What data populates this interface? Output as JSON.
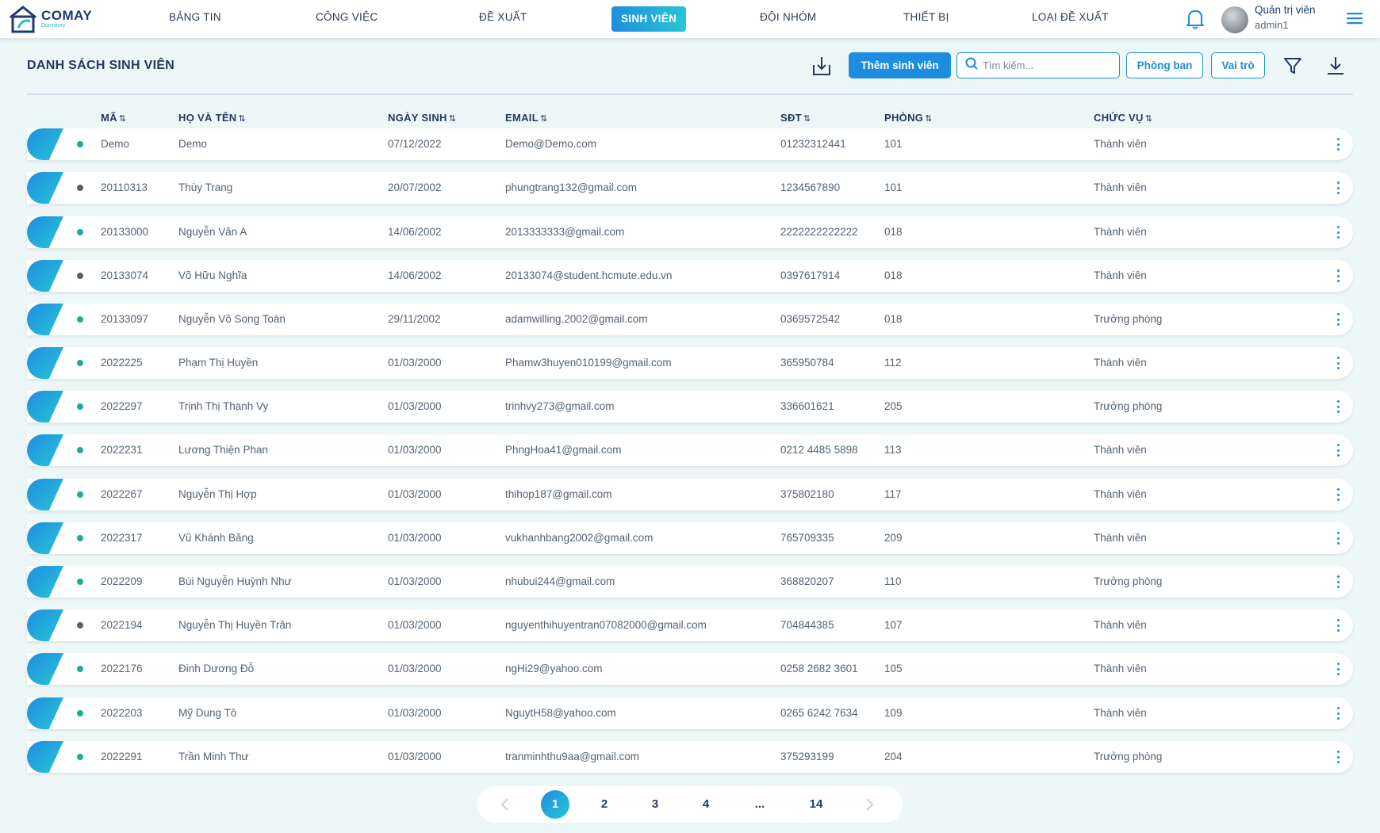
{
  "brand": {
    "name": "COMAY",
    "subtitle": "Dormitory"
  },
  "nav": {
    "items": [
      {
        "label": "BẢNG TIN"
      },
      {
        "label": "CÔNG VIỆC"
      },
      {
        "label": "ĐỀ XUẤT"
      },
      {
        "label": "SINH VIÊN",
        "active": true
      },
      {
        "label": "ĐỘI NHÓM"
      },
      {
        "label": "THIẾT BỊ"
      },
      {
        "label": "LOẠI ĐỀ XUẤT"
      }
    ]
  },
  "user": {
    "name": "Quản trị viên",
    "role": "admin1"
  },
  "header": {
    "title": "DANH SÁCH SINH VIÊN",
    "add_label": "Thêm sinh viên",
    "search_placeholder": "Tìm kiếm...",
    "department_label": "Phòng ban",
    "role_label": "Vai trò"
  },
  "table": {
    "columns": [
      "MÃ",
      "HỌ VÀ TÊN",
      "NGÀY SINH",
      "EMAIL",
      "SĐT",
      "PHÒNG",
      "CHỨC VỤ"
    ],
    "rows": [
      {
        "status": "active",
        "id": "Demo",
        "name": "Demo",
        "dob": "07/12/2022",
        "email": "Demo@Demo.com",
        "phone": "01232312441",
        "room": "101",
        "position": "Thành viên"
      },
      {
        "status": "inactive",
        "id": "20110313",
        "name": "Thùy Trang",
        "dob": "20/07/2002",
        "email": "phungtrang132@gmail.com",
        "phone": "1234567890",
        "room": "101",
        "position": "Thành viên"
      },
      {
        "status": "active",
        "id": "20133000",
        "name": "Nguyễn Văn A",
        "dob": "14/06/2002",
        "email": "2013333333@gmail.com",
        "phone": "2222222222222",
        "room": "018",
        "position": "Thành viên"
      },
      {
        "status": "inactive",
        "id": "20133074",
        "name": "Võ Hữu Nghĩa",
        "dob": "14/06/2002",
        "email": "20133074@student.hcmute.edu.vn",
        "phone": "0397617914",
        "room": "018",
        "position": "Thành viên"
      },
      {
        "status": "active",
        "id": "20133097",
        "name": "Nguyễn Võ Song Toàn",
        "dob": "29/11/2002",
        "email": "adamwilling.2002@gmail.com",
        "phone": "0369572542",
        "room": "018",
        "position": "Trưởng phòng"
      },
      {
        "status": "active",
        "id": "2022225",
        "name": "Phạm Thị Huyền",
        "dob": "01/03/2000",
        "email": "Phamw3huyen010199@gmail.com",
        "phone": "365950784",
        "room": "112",
        "position": "Thành viên"
      },
      {
        "status": "active",
        "id": "2022297",
        "name": "Trịnh Thị Thanh Vy",
        "dob": "01/03/2000",
        "email": "trinhvy273@gmail.com",
        "phone": "336601621",
        "room": "205",
        "position": "Trưởng phòng"
      },
      {
        "status": "active",
        "id": "2022231",
        "name": "Lương Thiện Phan",
        "dob": "01/03/2000",
        "email": "PhngHoa41@gmail.com",
        "phone": "0212 4485 5898",
        "room": "113",
        "position": "Thành viên"
      },
      {
        "status": "active",
        "id": "2022267",
        "name": "Nguyễn Thị Hợp",
        "dob": "01/03/2000",
        "email": "thihop187@gmail.com",
        "phone": "375802180",
        "room": "117",
        "position": "Thành viên"
      },
      {
        "status": "active",
        "id": "2022317",
        "name": "Vũ Khánh Băng",
        "dob": "01/03/2000",
        "email": "vukhanhbang2002@gmail.com",
        "phone": "765709335",
        "room": "209",
        "position": "Thành viên"
      },
      {
        "status": "active",
        "id": "2022209",
        "name": "Bùi Nguyễn Huỳnh Như",
        "dob": "01/03/2000",
        "email": "nhubui244@gmail.com",
        "phone": "368820207",
        "room": "110",
        "position": "Trưởng phòng"
      },
      {
        "status": "inactive",
        "id": "2022194",
        "name": "Nguyễn Thị Huyền Trân",
        "dob": "01/03/2000",
        "email": "nguyenthihuyentran07082000@gmail.com",
        "phone": "704844385",
        "room": "107",
        "position": "Thành viên"
      },
      {
        "status": "active",
        "id": "2022176",
        "name": "Đinh Dương Đỗ",
        "dob": "01/03/2000",
        "email": "ngHi29@yahoo.com",
        "phone": "0258 2682 3601",
        "room": "105",
        "position": "Thành viên"
      },
      {
        "status": "active",
        "id": "2022203",
        "name": "Mỹ Dung Tô",
        "dob": "01/03/2000",
        "email": "NguytH58@yahoo.com",
        "phone": "0265 6242 7634",
        "room": "109",
        "position": "Thành viên"
      },
      {
        "status": "active",
        "id": "2022291",
        "name": "Trần Minh Thư",
        "dob": "01/03/2000",
        "email": "tranminhthu9aa@gmail.com",
        "phone": "375293199",
        "room": "204",
        "position": "Trưởng phòng"
      }
    ]
  },
  "pagination": {
    "pages": [
      "1",
      "2",
      "3",
      "4",
      "...",
      "14"
    ],
    "current": "1"
  },
  "colors": {
    "accent": "#1e8de0",
    "accent2": "#29c5d6",
    "active_dot": "#20a89a",
    "inactive_dot": "#5a5f66",
    "bg": "#eef7f8"
  }
}
